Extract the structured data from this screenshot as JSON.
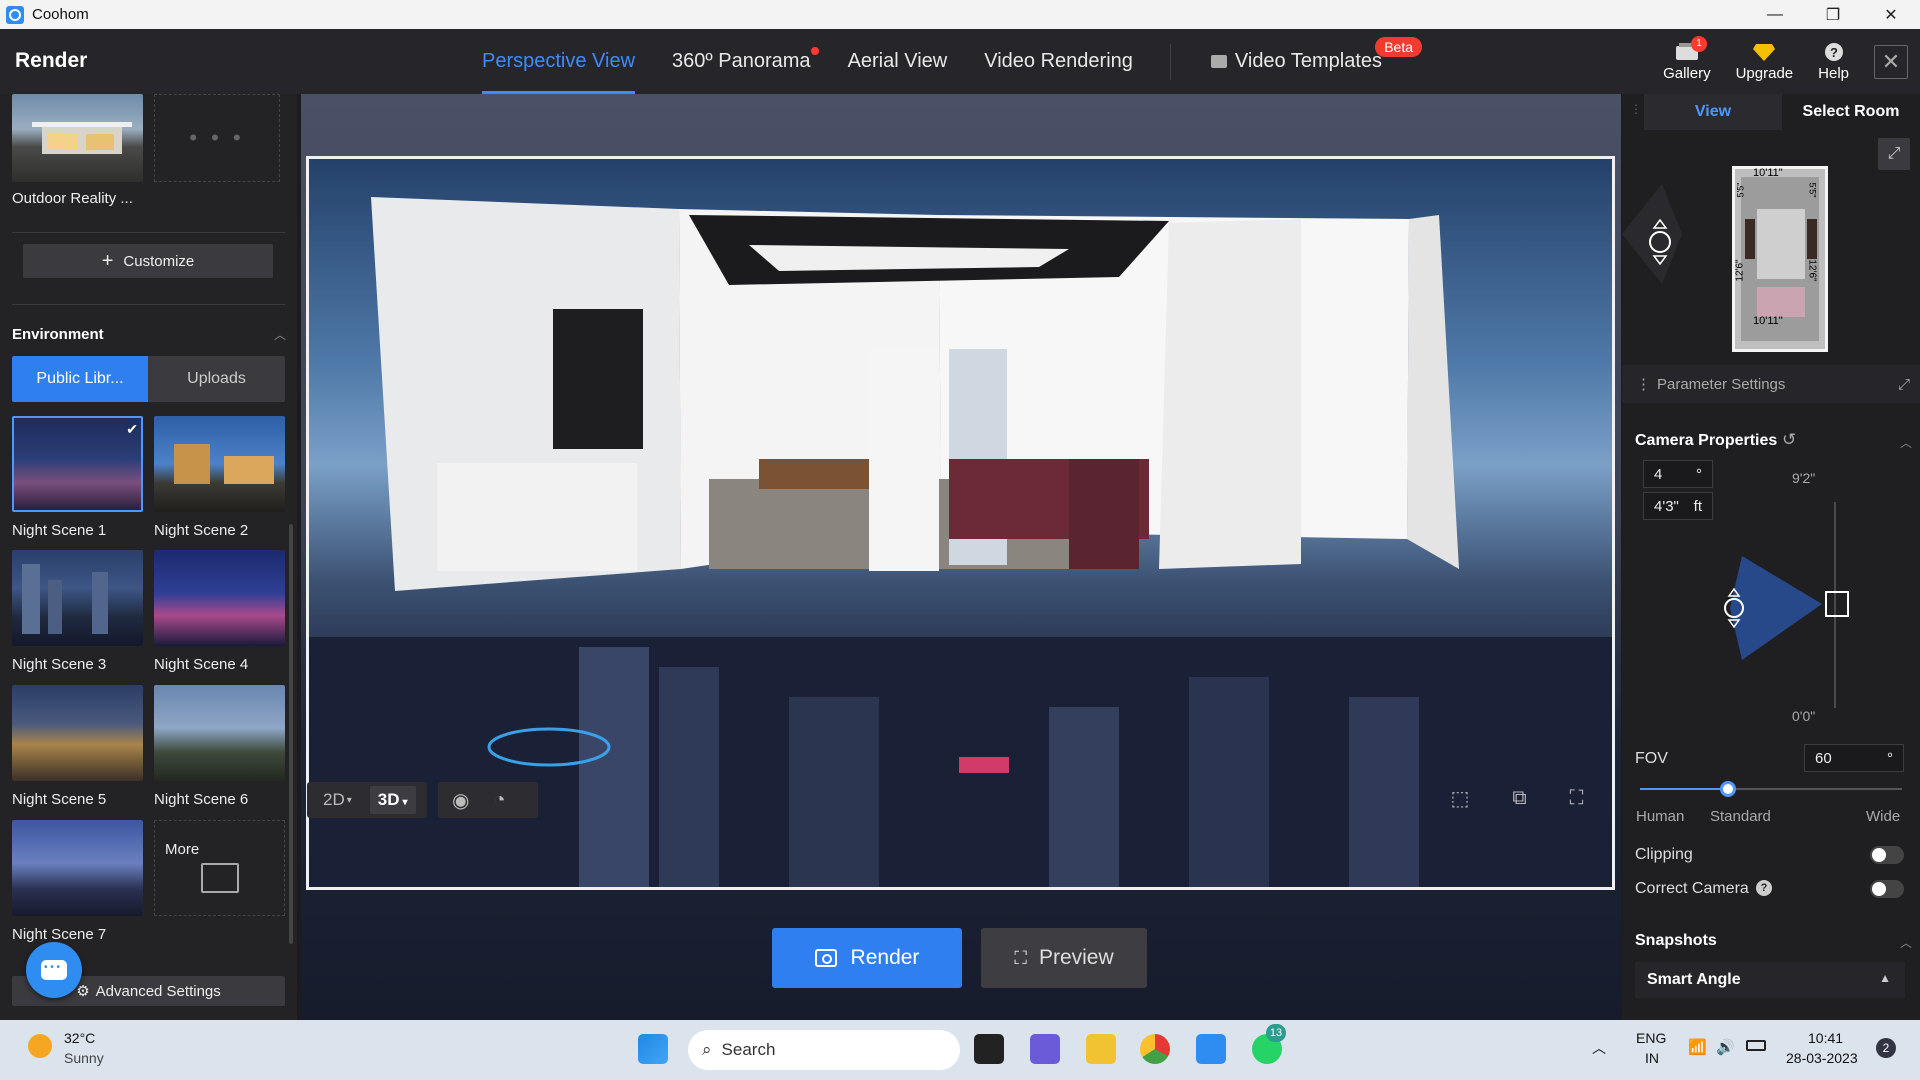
{
  "window": {
    "app_title": "Coohom",
    "buttons": [
      "—",
      "❐",
      "✕"
    ]
  },
  "topbar": {
    "brand": "Render",
    "tabs": [
      {
        "label": "Perspective View",
        "active": true
      },
      {
        "label": "360º Panorama",
        "dot": true
      },
      {
        "label": "Aerial View"
      },
      {
        "label": "Video Rendering"
      }
    ],
    "video_templates": {
      "label": "Video Templates",
      "badge": "Beta"
    },
    "right": {
      "gallery": {
        "label": "Gallery",
        "badge": "1"
      },
      "upgrade": {
        "label": "Upgrade"
      },
      "help": {
        "label": "Help"
      }
    }
  },
  "left": {
    "outdoor_label": "Outdoor Reality ...",
    "customize": "Customize",
    "environment": "Environment",
    "seg_public": "Public Libr...",
    "seg_uploads": "Uploads",
    "scenes": [
      "Night Scene 1",
      "Night Scene 2",
      "Night Scene 3",
      "Night Scene 4",
      "Night Scene 5",
      "Night Scene 6",
      "Night Scene 7"
    ],
    "more": "More",
    "advanced": "Advanced Settings"
  },
  "viewport": {
    "mode_2d": "2D",
    "mode_3d": "3D",
    "render": "Render",
    "preview": "Preview"
  },
  "right": {
    "tab_view": "View",
    "tab_select_room": "Select Room",
    "plan_dims": [
      "10'11\"",
      "10'11\"",
      "12'6\"",
      "12'6\"",
      "5'5\"",
      "5'5\""
    ],
    "param_settings": "Parameter Settings",
    "camera_props": "Camera Properties",
    "angle_value": "4",
    "angle_unit": "°",
    "height_value": "4'3\"",
    "height_unit": "ft",
    "max_height": "9'2\"",
    "min_height": "0'0\"",
    "fov_label": "FOV",
    "fov_value": "60",
    "fov_unit": "°",
    "fov_labels": [
      "Human",
      "Standard",
      "Wide"
    ],
    "clipping": "Clipping",
    "correct_camera": "Correct Camera",
    "snapshots": "Snapshots",
    "smart_angle": "Smart Angle"
  },
  "taskbar": {
    "temp": "32°C",
    "weather": "Sunny",
    "search": "Search",
    "lang1": "ENG",
    "lang2": "IN",
    "time": "10:41",
    "date": "28-03-2023",
    "notif": "2",
    "whatsapp_badge": "13"
  }
}
